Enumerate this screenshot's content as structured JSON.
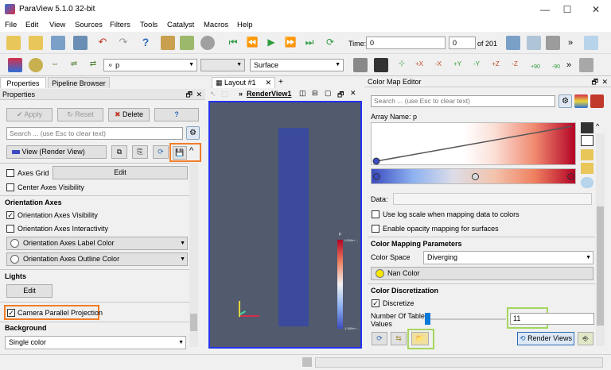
{
  "window": {
    "title": "ParaView 5.1.0 32-bit",
    "minimize": "—",
    "maximize": "☐",
    "close": "✕"
  },
  "menu": [
    "File",
    "Edit",
    "View",
    "Sources",
    "Filters",
    "Tools",
    "Catalyst",
    "Macros",
    "Help"
  ],
  "toolbar": {
    "time_label": "Time:",
    "time_value": "0",
    "frame_value": "0",
    "frame_of": "of 201",
    "more": "»"
  },
  "toolbar2": {
    "array_combo": "p",
    "array_prefix": "⚬",
    "repr_combo": "Surface",
    "more": "»",
    "cam_plus90": "+90",
    "cam_minus90": "-90"
  },
  "left_panel": {
    "tabs": [
      "Properties",
      "Pipeline Browser"
    ],
    "header": "Properties",
    "apply": "Apply",
    "reset": "Reset",
    "delete": "Delete",
    "help": "?",
    "search_placeholder": "Search ... (use Esc to clear text)",
    "view_label": "View (Render View)",
    "axes_grid": "Axes Grid",
    "edit": "Edit",
    "center_axes": "Center Axes Visibility",
    "orientation_section": "Orientation Axes",
    "orient_visibility": "Orientation Axes Visibility",
    "orient_interactivity": "Orientation Axes Interactivity",
    "orient_label_color": "Orientation Axes Label Color",
    "orient_outline_color": "Orientation Axes Outline Color",
    "lights_section": "Lights",
    "lights_edit": "Edit",
    "camera_parallel": "Camera Parallel Projection",
    "background_section": "Background",
    "background_combo": "Single color"
  },
  "center": {
    "tab": "Layout #1",
    "tab_close": "✕",
    "tab_add": "+",
    "view_name": "RenderView1",
    "more": "»",
    "scalar_bar_title": "p",
    "scalar_top": "1.000e+...",
    "scalar_bottom": "-1.000e+..."
  },
  "right_panel": {
    "header": "Color Map Editor",
    "search_placeholder": "Search ... (use Esc to clear text)",
    "array_name": "Array Name: p",
    "data_label": "Data:",
    "log_scale": "Use log scale when mapping data to colors",
    "opacity_mapping": "Enable opacity mapping for surfaces",
    "mapping_section": "Color Mapping Parameters",
    "color_space_label": "Color Space",
    "color_space_value": "Diverging",
    "nan_color": "Nan Color",
    "discretization_section": "Color Discretization",
    "discretize": "Discretize",
    "table_values_label": "Number Of Table Values",
    "table_values": "11",
    "render_views": "Render Views",
    "colors": {
      "cool": "#3b4cc0",
      "warm": "#b40426"
    }
  }
}
